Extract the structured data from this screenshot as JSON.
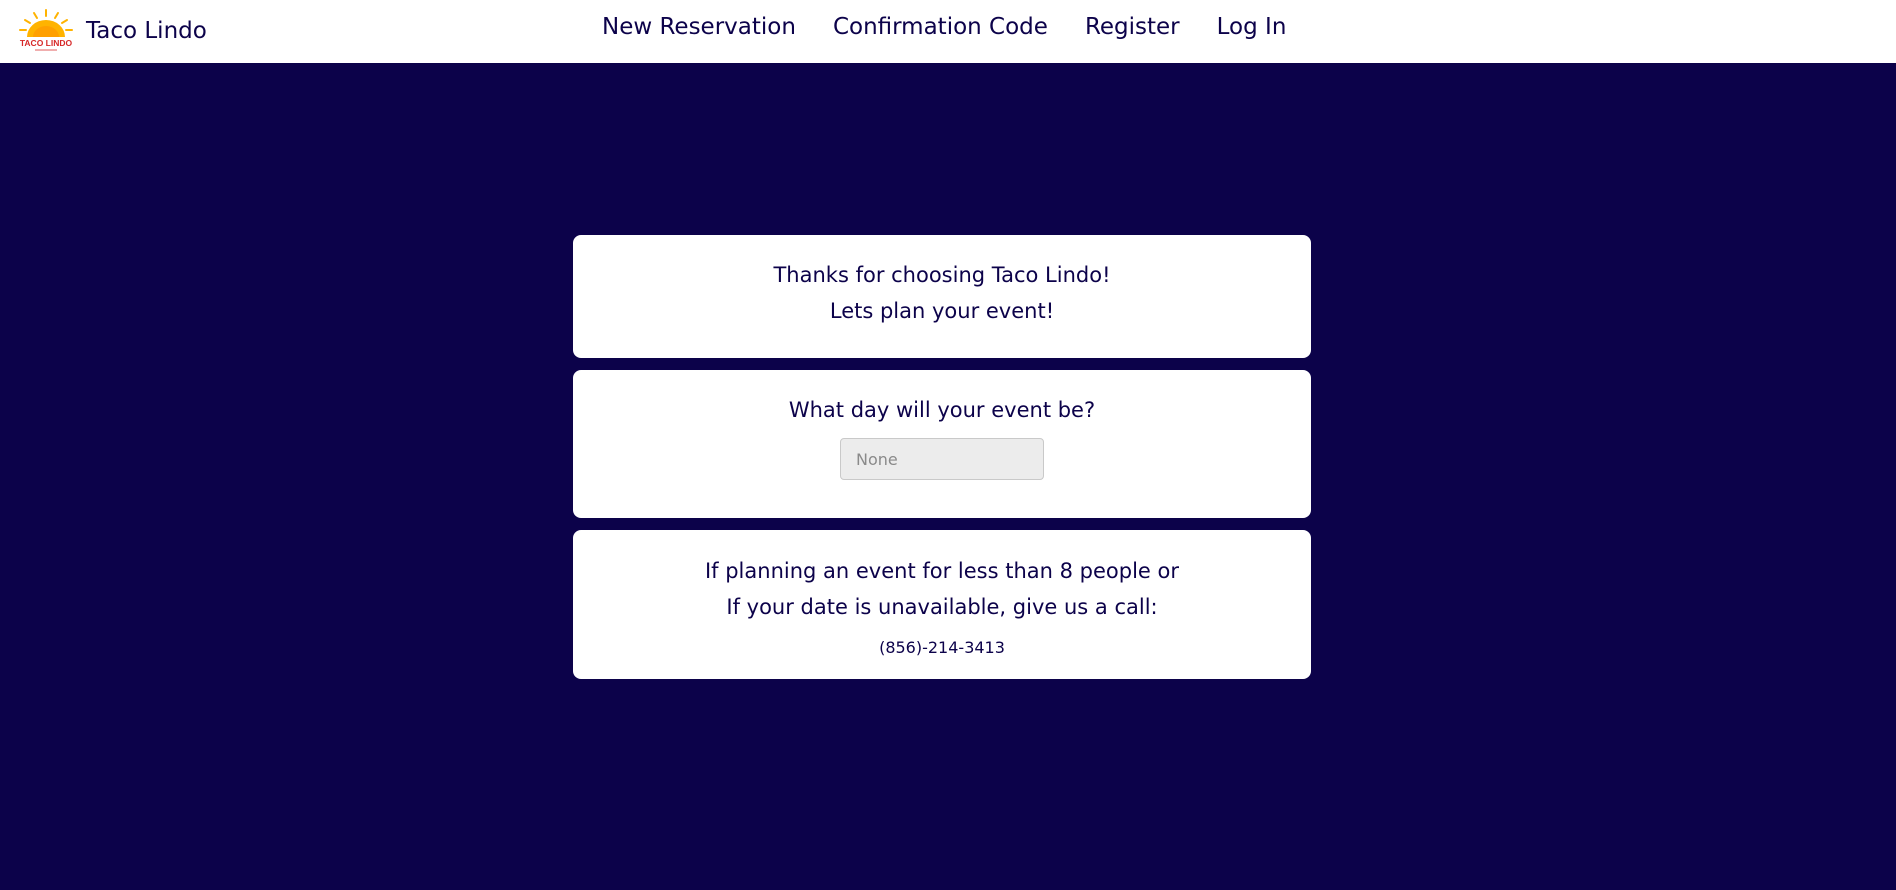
{
  "header": {
    "brand_name": "Taco Lindo",
    "logo_text": "TACO LINDO",
    "logo_icon": "sun-logo-icon",
    "nav": [
      "New Reservation",
      "Confirmation Code",
      "Register",
      "Log In"
    ]
  },
  "welcome_card": {
    "line1": "Thanks for choosing Taco Lindo!",
    "line2": "Lets plan your event!"
  },
  "date_card": {
    "question": "What day will your event be?",
    "input_placeholder": "None"
  },
  "call_card": {
    "line1": "If planning an event for less than 8 people or",
    "line2": "If your date is unavailable, give us a call:",
    "phone": "(856)-214-3413"
  },
  "colors": {
    "background": "#0c024a",
    "text": "#0c024a",
    "card": "#ffffff",
    "logo_sun": "#ffb300",
    "logo_text": "#d62828"
  }
}
